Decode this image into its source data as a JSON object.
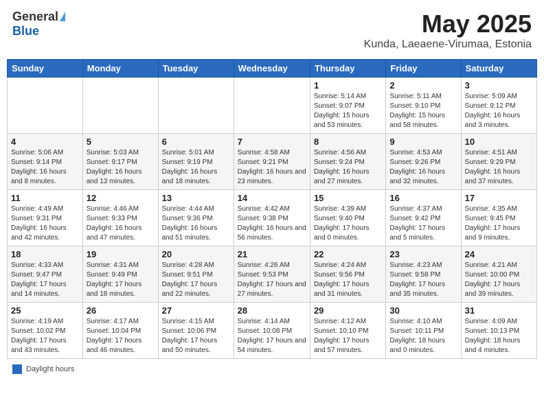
{
  "header": {
    "logo_general": "General",
    "logo_blue": "Blue",
    "month": "May 2025",
    "location": "Kunda, Laeaene-Virumaa, Estonia"
  },
  "weekdays": [
    "Sunday",
    "Monday",
    "Tuesday",
    "Wednesday",
    "Thursday",
    "Friday",
    "Saturday"
  ],
  "weeks": [
    [
      {
        "day": "",
        "info": ""
      },
      {
        "day": "",
        "info": ""
      },
      {
        "day": "",
        "info": ""
      },
      {
        "day": "",
        "info": ""
      },
      {
        "day": "1",
        "info": "Sunrise: 5:14 AM\nSunset: 9:07 PM\nDaylight: 15 hours\nand 53 minutes."
      },
      {
        "day": "2",
        "info": "Sunrise: 5:11 AM\nSunset: 9:10 PM\nDaylight: 15 hours\nand 58 minutes."
      },
      {
        "day": "3",
        "info": "Sunrise: 5:09 AM\nSunset: 9:12 PM\nDaylight: 16 hours\nand 3 minutes."
      }
    ],
    [
      {
        "day": "4",
        "info": "Sunrise: 5:06 AM\nSunset: 9:14 PM\nDaylight: 16 hours\nand 8 minutes."
      },
      {
        "day": "5",
        "info": "Sunrise: 5:03 AM\nSunset: 9:17 PM\nDaylight: 16 hours\nand 13 minutes."
      },
      {
        "day": "6",
        "info": "Sunrise: 5:01 AM\nSunset: 9:19 PM\nDaylight: 16 hours\nand 18 minutes."
      },
      {
        "day": "7",
        "info": "Sunrise: 4:58 AM\nSunset: 9:21 PM\nDaylight: 16 hours\nand 23 minutes."
      },
      {
        "day": "8",
        "info": "Sunrise: 4:56 AM\nSunset: 9:24 PM\nDaylight: 16 hours\nand 27 minutes."
      },
      {
        "day": "9",
        "info": "Sunrise: 4:53 AM\nSunset: 9:26 PM\nDaylight: 16 hours\nand 32 minutes."
      },
      {
        "day": "10",
        "info": "Sunrise: 4:51 AM\nSunset: 9:29 PM\nDaylight: 16 hours\nand 37 minutes."
      }
    ],
    [
      {
        "day": "11",
        "info": "Sunrise: 4:49 AM\nSunset: 9:31 PM\nDaylight: 16 hours\nand 42 minutes."
      },
      {
        "day": "12",
        "info": "Sunrise: 4:46 AM\nSunset: 9:33 PM\nDaylight: 16 hours\nand 47 minutes."
      },
      {
        "day": "13",
        "info": "Sunrise: 4:44 AM\nSunset: 9:36 PM\nDaylight: 16 hours\nand 51 minutes."
      },
      {
        "day": "14",
        "info": "Sunrise: 4:42 AM\nSunset: 9:38 PM\nDaylight: 16 hours\nand 56 minutes."
      },
      {
        "day": "15",
        "info": "Sunrise: 4:39 AM\nSunset: 9:40 PM\nDaylight: 17 hours\nand 0 minutes."
      },
      {
        "day": "16",
        "info": "Sunrise: 4:37 AM\nSunset: 9:42 PM\nDaylight: 17 hours\nand 5 minutes."
      },
      {
        "day": "17",
        "info": "Sunrise: 4:35 AM\nSunset: 9:45 PM\nDaylight: 17 hours\nand 9 minutes."
      }
    ],
    [
      {
        "day": "18",
        "info": "Sunrise: 4:33 AM\nSunset: 9:47 PM\nDaylight: 17 hours\nand 14 minutes."
      },
      {
        "day": "19",
        "info": "Sunrise: 4:31 AM\nSunset: 9:49 PM\nDaylight: 17 hours\nand 18 minutes."
      },
      {
        "day": "20",
        "info": "Sunrise: 4:28 AM\nSunset: 9:51 PM\nDaylight: 17 hours\nand 22 minutes."
      },
      {
        "day": "21",
        "info": "Sunrise: 4:26 AM\nSunset: 9:53 PM\nDaylight: 17 hours\nand 27 minutes."
      },
      {
        "day": "22",
        "info": "Sunrise: 4:24 AM\nSunset: 9:56 PM\nDaylight: 17 hours\nand 31 minutes."
      },
      {
        "day": "23",
        "info": "Sunrise: 4:23 AM\nSunset: 9:58 PM\nDaylight: 17 hours\nand 35 minutes."
      },
      {
        "day": "24",
        "info": "Sunrise: 4:21 AM\nSunset: 10:00 PM\nDaylight: 17 hours\nand 39 minutes."
      }
    ],
    [
      {
        "day": "25",
        "info": "Sunrise: 4:19 AM\nSunset: 10:02 PM\nDaylight: 17 hours\nand 43 minutes."
      },
      {
        "day": "26",
        "info": "Sunrise: 4:17 AM\nSunset: 10:04 PM\nDaylight: 17 hours\nand 46 minutes."
      },
      {
        "day": "27",
        "info": "Sunrise: 4:15 AM\nSunset: 10:06 PM\nDaylight: 17 hours\nand 50 minutes."
      },
      {
        "day": "28",
        "info": "Sunrise: 4:14 AM\nSunset: 10:08 PM\nDaylight: 17 hours\nand 54 minutes."
      },
      {
        "day": "29",
        "info": "Sunrise: 4:12 AM\nSunset: 10:10 PM\nDaylight: 17 hours\nand 57 minutes."
      },
      {
        "day": "30",
        "info": "Sunrise: 4:10 AM\nSunset: 10:11 PM\nDaylight: 18 hours\nand 0 minutes."
      },
      {
        "day": "31",
        "info": "Sunrise: 4:09 AM\nSunset: 10:13 PM\nDaylight: 18 hours\nand 4 minutes."
      }
    ]
  ],
  "footer": {
    "legend_label": "Daylight hours"
  }
}
